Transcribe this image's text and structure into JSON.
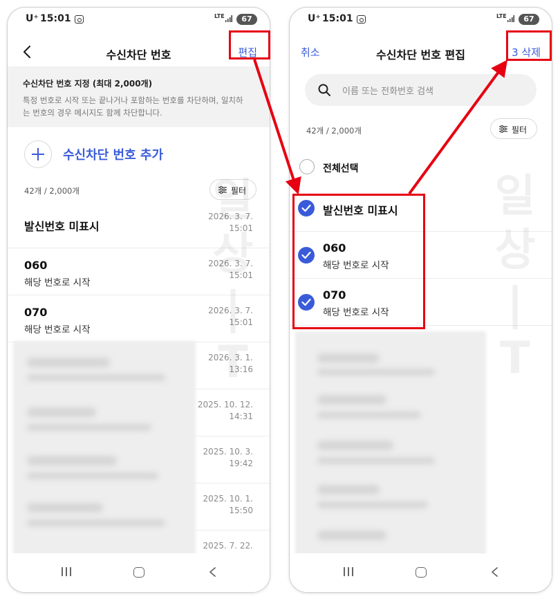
{
  "status": {
    "carrier": "U⁺",
    "time": "15:01",
    "network": "LTE",
    "battery": "67"
  },
  "accent_color": "#3a5bd9",
  "highlight_color": "#e60012",
  "left_screen": {
    "title": "수신차단 번호",
    "edit_label": "편집",
    "info": {
      "title": "수신차단 번호 지정 (최대 2,000개)",
      "description": "특정 번호로 시작 또는 끝나거나 포함하는 번호를 차단하며, 일치하는 번호의 경우 메시지도 함께 차단합니다."
    },
    "add_label": "수신차단 번호 추가",
    "count": "42개 / 2,000개",
    "filter_label": "필터",
    "rows": [
      {
        "name": "발신번호 미표시",
        "sub": "",
        "date": "2026. 3. 7.",
        "time": "15:01"
      },
      {
        "name": "060",
        "sub": "해당 번호로 시작",
        "date": "2026. 3. 7.",
        "time": "15:01"
      },
      {
        "name": "070",
        "sub": "해당 번호로 시작",
        "date": "2026. 3. 7.",
        "time": "15:01"
      },
      {
        "name": "",
        "sub": "",
        "date": "2026. 3. 1.",
        "time": "13:16"
      },
      {
        "name": "",
        "sub": "",
        "date": "2025. 10. 12.",
        "time": "14:31"
      },
      {
        "name": "",
        "sub": "",
        "date": "2025. 10. 3.",
        "time": "19:42"
      },
      {
        "name": "",
        "sub": "",
        "date": "2025. 10. 1.",
        "time": "15:50"
      },
      {
        "name": "",
        "sub": "",
        "date": "2025. 7. 22.",
        "time": ""
      }
    ]
  },
  "right_screen": {
    "cancel_label": "취소",
    "title": "수신차단 번호 편집",
    "delete_label": "3 삭제",
    "search_placeholder": "이름 또는 전화번호 검색",
    "count": "42개 / 2,000개",
    "filter_label": "필터",
    "select_all_label": "전체선택",
    "rows": [
      {
        "name": "발신번호 미표시",
        "sub": "",
        "checked": true
      },
      {
        "name": "060",
        "sub": "해당 번호로 시작",
        "checked": true
      },
      {
        "name": "070",
        "sub": "해당 번호로 시작",
        "checked": true
      }
    ]
  },
  "watermark": {
    "chars": [
      "일",
      "상",
      "|",
      "T"
    ]
  },
  "icons": [
    "back-arrow-icon",
    "plus-icon",
    "filter-icon",
    "search-icon",
    "check-icon",
    "nav-recent-icon",
    "nav-home-icon",
    "nav-back-icon",
    "screenshot-icon"
  ]
}
